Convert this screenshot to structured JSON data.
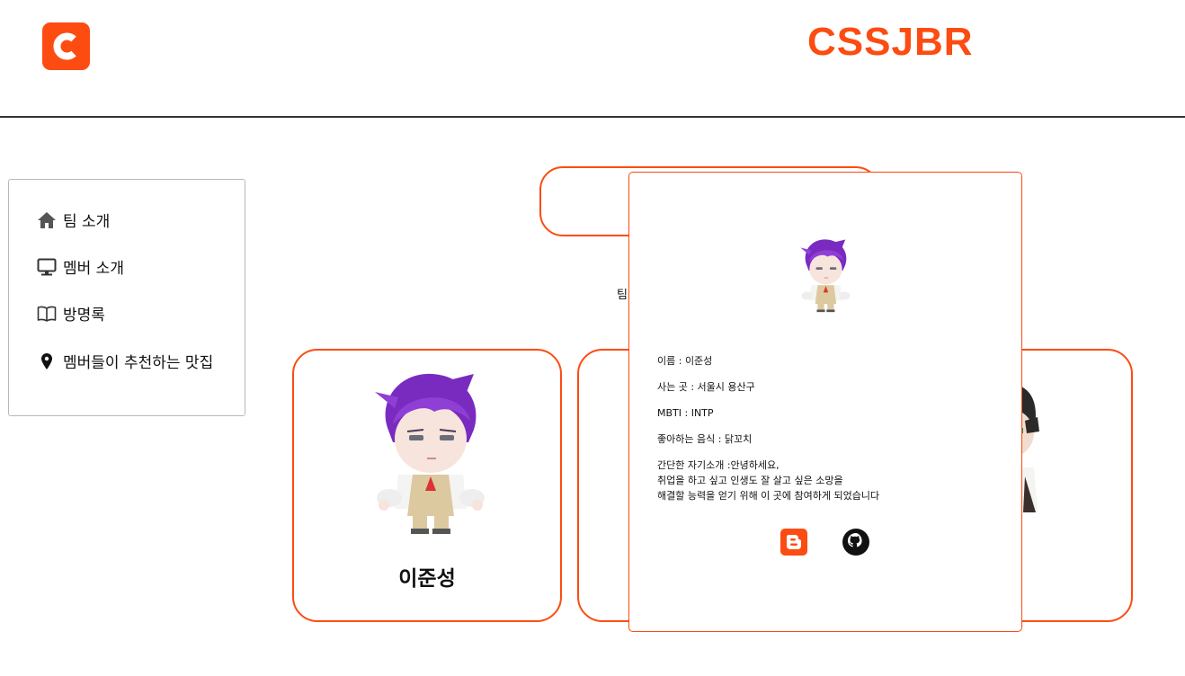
{
  "header": {
    "logo_icon": "cssjbr-logo-icon",
    "brand": "CSSJBR",
    "accent_color": "#fc4c12"
  },
  "sidebar": {
    "items": [
      {
        "icon": "home-icon",
        "label": "팀 소개"
      },
      {
        "icon": "monitor-icon",
        "label": "멤버 소개"
      },
      {
        "icon": "book-icon",
        "label": "방명록"
      },
      {
        "icon": "map-pin-icon",
        "label": "멤버들이 추천하는 맛집"
      }
    ]
  },
  "main": {
    "team_desc_visible": "팀",
    "members": [
      {
        "name": "이준성",
        "avatar": "purple-hair-character"
      },
      {
        "name": "",
        "avatar": ""
      },
      {
        "name": "",
        "avatar": "dark-hair-character"
      }
    ]
  },
  "modal": {
    "avatar": "purple-hair-character",
    "name_line": "이름 : 이준성",
    "residence_line": "사는 곳 : 서울시 용산구",
    "mbti_line": "MBTI : INTP",
    "food_line": "좋아하는 음식 : 닭꼬치",
    "intro_lines": [
      "간단한 자기소개 :안녕하세요,",
      "취업을 하고 싶고 인생도 잘 살고 싶은 소망을",
      "해결할 능력을 얻기 위해 이 곳에 참여하게 되었습니다"
    ],
    "links": [
      {
        "icon": "blogger-icon"
      },
      {
        "icon": "github-icon"
      }
    ]
  }
}
